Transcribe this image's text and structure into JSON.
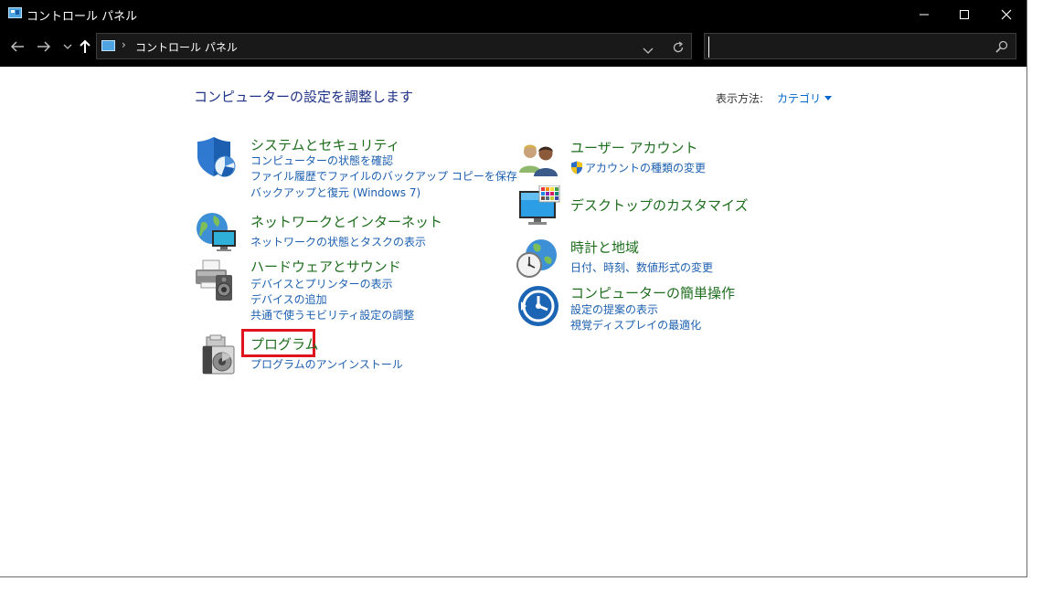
{
  "window": {
    "title": "コントロール パネル"
  },
  "address": {
    "separator": "›",
    "path": "コントロール パネル"
  },
  "search": {
    "value": "",
    "placeholder": ""
  },
  "page": {
    "title": "コンピューターの設定を調整します",
    "view_label": "表示方法:",
    "view_value": "カテゴリ"
  },
  "categories_left": [
    {
      "title": "システムとセキュリティ",
      "links": [
        "コンピューターの状態を確認",
        "ファイル履歴でファイルのバックアップ コピーを保存",
        "バックアップと復元 (Windows 7)"
      ]
    },
    {
      "title": "ネットワークとインターネット",
      "links": [
        "ネットワークの状態とタスクの表示"
      ]
    },
    {
      "title": "ハードウェアとサウンド",
      "links": [
        "デバイスとプリンターの表示",
        "デバイスの追加",
        "共通で使うモビリティ設定の調整"
      ]
    },
    {
      "title": "プログラム",
      "links": [
        "プログラムのアンインストール"
      ]
    }
  ],
  "categories_right": [
    {
      "title": "ユーザー アカウント",
      "links": [
        "アカウントの種類の変更"
      ]
    },
    {
      "title": "デスクトップのカスタマイズ",
      "links": []
    },
    {
      "title": "時計と地域",
      "links": [
        "日付、時刻、数値形式の変更"
      ]
    },
    {
      "title": "コンピューターの簡単操作",
      "links": [
        "設定の提案の表示",
        "視覚ディスプレイの最適化"
      ]
    }
  ],
  "colors": {
    "titlebar": "#000000",
    "category_title": "#1e6e1e",
    "link": "#1c5fb0",
    "highlight": "#e0141e"
  }
}
